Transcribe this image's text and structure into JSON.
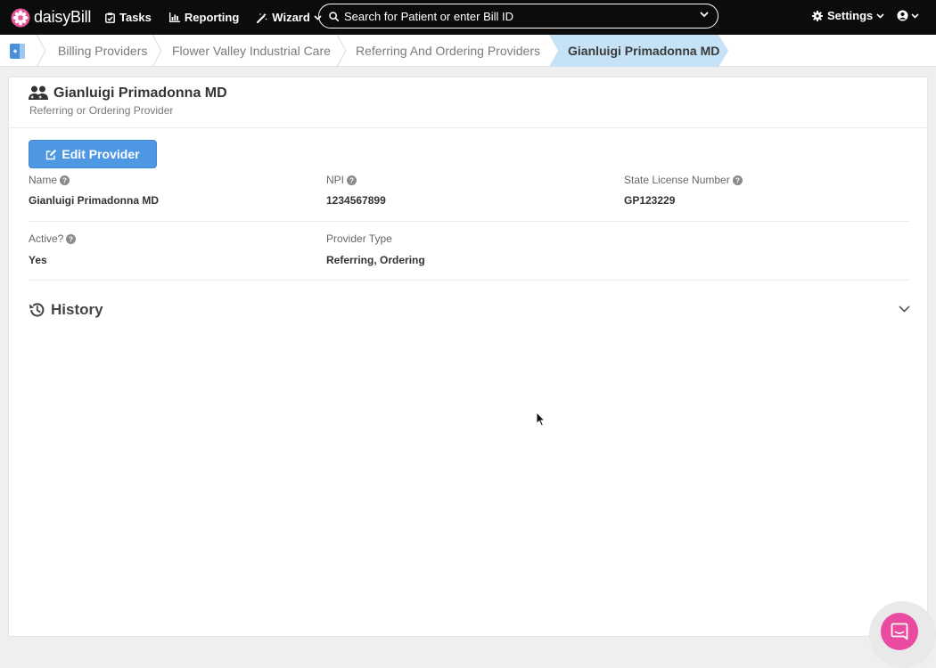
{
  "brand": {
    "name": "daisyBill"
  },
  "nav": {
    "tasks": "Tasks",
    "reporting": "Reporting",
    "wizard": "Wizard",
    "settings": "Settings"
  },
  "search": {
    "placeholder": "Search for Patient or enter Bill ID"
  },
  "breadcrumb": {
    "items": [
      "Billing Providers",
      "Flower Valley Industrial Care",
      "Referring And Ordering Providers"
    ],
    "current": "Gianluigi Primadonna MD"
  },
  "page": {
    "title": "Gianluigi Primadonna MD",
    "subtitle": "Referring or Ordering Provider",
    "edit_button": "Edit Provider"
  },
  "fields": {
    "name": {
      "label": "Name",
      "value": "Gianluigi Primadonna MD"
    },
    "npi": {
      "label": "NPI",
      "value": "1234567899"
    },
    "license": {
      "label": "State License Number",
      "value": "GP123229"
    },
    "active": {
      "label": "Active?",
      "value": "Yes"
    },
    "provider_type": {
      "label": "Provider Type",
      "value": "Referring, Ordering"
    }
  },
  "history": {
    "title": "History"
  },
  "colors": {
    "nav_bg": "#0c0c0c",
    "accent_blue": "#4d97e3",
    "breadcrumb_active": "#c5e2f7",
    "chat_pink": "#ea4aa0",
    "brand_pink": "#e8579b"
  }
}
